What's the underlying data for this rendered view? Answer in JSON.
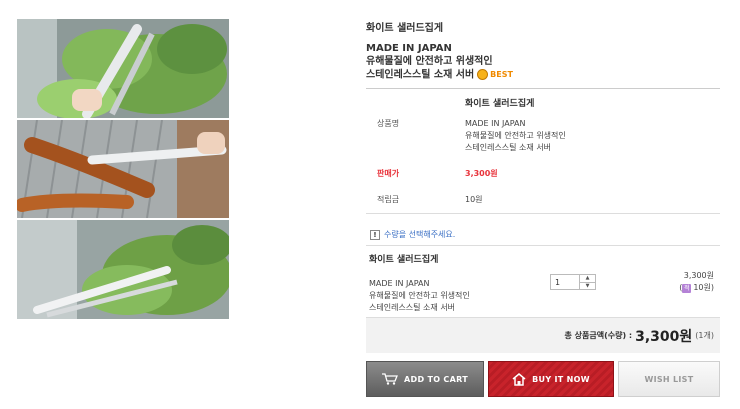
{
  "product": {
    "name": "화이트 샐러드집게",
    "desc_lines": [
      "MADE IN JAPAN",
      "유해물질에 안전하고 위생적인",
      "스테인레스스틸 소재 서버"
    ],
    "best_badge": "BEST"
  },
  "table": {
    "title": "화이트 샐러드집게",
    "rows": [
      {
        "label": "상품명",
        "value_lines": [
          "MADE IN JAPAN",
          "유해물질에 안전하고 위생적인",
          "스테인레스스틸 소재 서버"
        ]
      },
      {
        "label": "판매가",
        "value": "3,300원"
      },
      {
        "label": "적립금",
        "value": "10원"
      }
    ]
  },
  "notice": "수량을 선택해주세요.",
  "option": {
    "title": "화이트 샐러드집게",
    "desc_lines": [
      "MADE IN JAPAN",
      "유해물질에 안전하고 위생적인",
      "스테인레스스틸 소재 서버"
    ],
    "quantity": "1",
    "price": "3,300원",
    "points": "10원"
  },
  "total": {
    "label": "총 상품금액(수량) :",
    "amount": "3,300원",
    "count": "(1개)"
  },
  "buttons": {
    "add_to_cart": "ADD TO CART",
    "buy_it_now": "BUY IT NOW",
    "wish_list": "WISH LIST"
  },
  "colors": {
    "price_red": "#e8333b",
    "notice_blue": "#3a6fc4",
    "buy_red": "#c8232b",
    "cart_gray": "#6e6e6e"
  }
}
